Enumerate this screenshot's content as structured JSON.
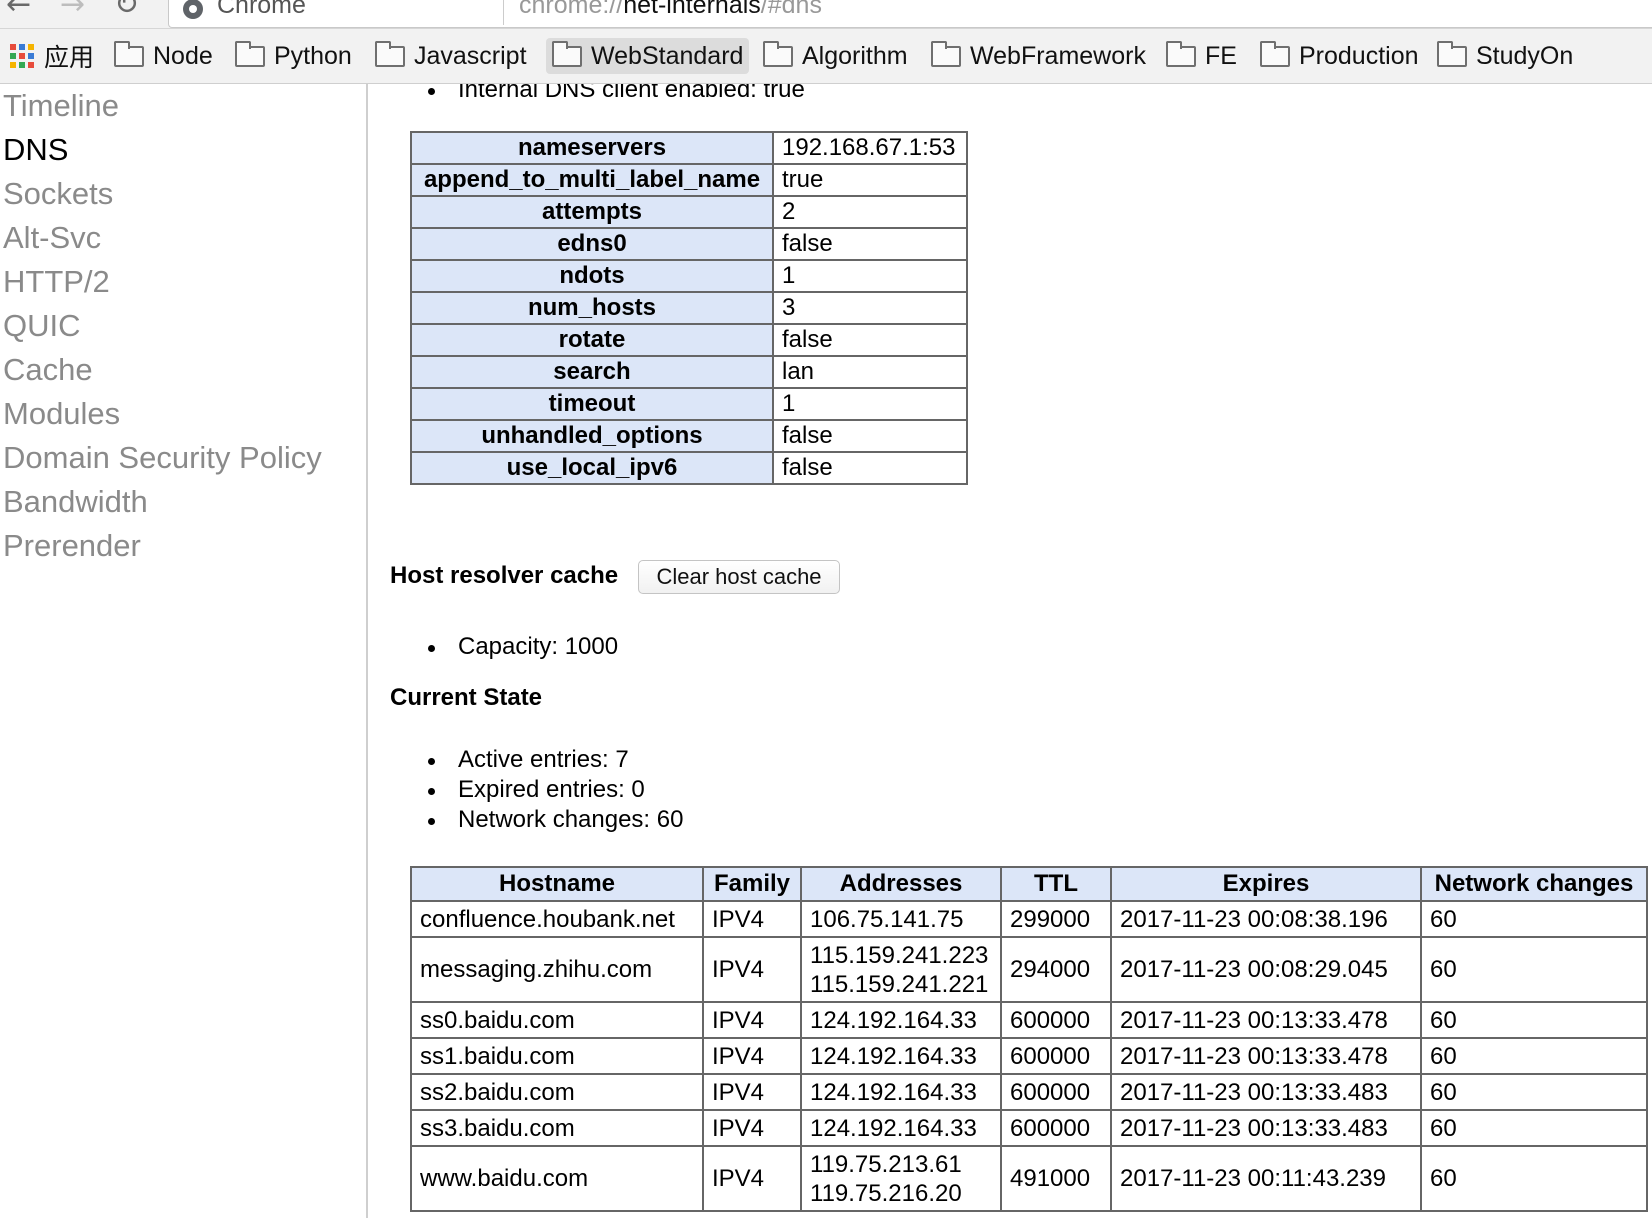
{
  "browser": {
    "site_name": "Chrome",
    "url_scheme": "chrome://",
    "url_host": "net-internals",
    "url_hash": "/#dns"
  },
  "bookmarks": {
    "apps_label": "应用",
    "items": [
      "Node",
      "Python",
      "Javascript",
      "WebStandard",
      "Algorithm",
      "WebFramework",
      "FE",
      "Production",
      "StudyOn"
    ],
    "active": "WebStandard",
    "apps_colors": [
      "#e74c3c",
      "#3a7bd5",
      "#f5b400",
      "#34a853",
      "#e74c3c",
      "#3a7bd5",
      "#f5b400",
      "#34a853",
      "#e74c3c"
    ]
  },
  "sidebar": {
    "items": [
      "Timeline",
      "DNS",
      "Sockets",
      "Alt-Svc",
      "HTTP/2",
      "QUIC",
      "Cache",
      "Modules",
      "Domain Security Policy",
      "Bandwidth",
      "Prerender"
    ],
    "current": "DNS"
  },
  "dns_config": {
    "bullet": "Internal DNS client enabled: true",
    "rows": [
      {
        "key": "nameservers",
        "value": "192.168.67.1:53"
      },
      {
        "key": "append_to_multi_label_name",
        "value": "true"
      },
      {
        "key": "attempts",
        "value": "2"
      },
      {
        "key": "edns0",
        "value": "false"
      },
      {
        "key": "ndots",
        "value": "1"
      },
      {
        "key": "num_hosts",
        "value": "3"
      },
      {
        "key": "rotate",
        "value": "false"
      },
      {
        "key": "search",
        "value": "lan"
      },
      {
        "key": "timeout",
        "value": "1"
      },
      {
        "key": "unhandled_options",
        "value": "false"
      },
      {
        "key": "use_local_ipv6",
        "value": "false"
      }
    ]
  },
  "host_cache": {
    "title": "Host resolver cache",
    "clear_button": "Clear host cache",
    "capacity": "Capacity: 1000"
  },
  "current_state": {
    "title": "Current State",
    "stats": [
      "Active entries: 7",
      "Expired entries: 0",
      "Network changes: 60"
    ],
    "columns": [
      "Hostname",
      "Family",
      "Addresses",
      "TTL",
      "Expires",
      "Network changes"
    ],
    "rows": [
      {
        "hostname": "confluence.houbank.net",
        "family": "IPV4",
        "addresses": [
          "106.75.141.75"
        ],
        "ttl": "299000",
        "expires": "2017-11-23 00:08:38.196",
        "network_changes": "60"
      },
      {
        "hostname": "messaging.zhihu.com",
        "family": "IPV4",
        "addresses": [
          "115.159.241.223",
          "115.159.241.221"
        ],
        "ttl": "294000",
        "expires": "2017-11-23 00:08:29.045",
        "network_changes": "60"
      },
      {
        "hostname": "ss0.baidu.com",
        "family": "IPV4",
        "addresses": [
          "124.192.164.33"
        ],
        "ttl": "600000",
        "expires": "2017-11-23 00:13:33.478",
        "network_changes": "60"
      },
      {
        "hostname": "ss1.baidu.com",
        "family": "IPV4",
        "addresses": [
          "124.192.164.33"
        ],
        "ttl": "600000",
        "expires": "2017-11-23 00:13:33.478",
        "network_changes": "60"
      },
      {
        "hostname": "ss2.baidu.com",
        "family": "IPV4",
        "addresses": [
          "124.192.164.33"
        ],
        "ttl": "600000",
        "expires": "2017-11-23 00:13:33.483",
        "network_changes": "60"
      },
      {
        "hostname": "ss3.baidu.com",
        "family": "IPV4",
        "addresses": [
          "124.192.164.33"
        ],
        "ttl": "600000",
        "expires": "2017-11-23 00:13:33.483",
        "network_changes": "60"
      },
      {
        "hostname": "www.baidu.com",
        "family": "IPV4",
        "addresses": [
          "119.75.213.61",
          "119.75.216.20"
        ],
        "ttl": "491000",
        "expires": "2017-11-23 00:11:43.239",
        "network_changes": "60"
      }
    ]
  },
  "colors": {
    "table_header_bg": "#dce6f8",
    "sidebar_inactive": "#8a8a8a",
    "sidebar_active": "#000000"
  }
}
